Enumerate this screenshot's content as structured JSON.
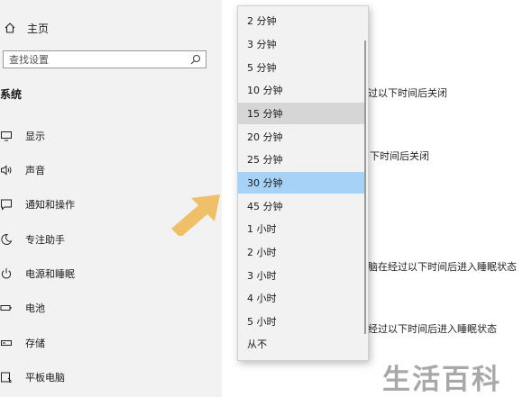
{
  "sidebar": {
    "home_label": "主页",
    "search_placeholder": "查找设置",
    "section_title": "系统",
    "items": [
      {
        "label": "显示",
        "icon": "monitor-icon"
      },
      {
        "label": "声音",
        "icon": "speaker-icon"
      },
      {
        "label": "通知和操作",
        "icon": "notification-icon"
      },
      {
        "label": "专注助手",
        "icon": "moon-icon"
      },
      {
        "label": "电源和睡眠",
        "icon": "power-icon"
      },
      {
        "label": "电池",
        "icon": "battery-icon"
      },
      {
        "label": "存储",
        "icon": "storage-icon"
      },
      {
        "label": "平板电脑",
        "icon": "tablet-icon"
      }
    ]
  },
  "content": {
    "line1": "过以下时间后关闭",
    "line2": "下时间后关闭",
    "line3": "脑在经过以下时间后进入睡眠状态",
    "line4": "经过以下时间后进入睡眠状态"
  },
  "dropdown": {
    "hovered_option": "15 分钟",
    "selected_option": "30 分钟",
    "options": [
      "2 分钟",
      "3 分钟",
      "5 分钟",
      "10 分钟",
      "15 分钟",
      "20 分钟",
      "25 分钟",
      "30 分钟",
      "45 分钟",
      "1 小时",
      "2 小时",
      "3 小时",
      "4 小时",
      "5 小时",
      "从不"
    ]
  },
  "watermark": "生活百科",
  "colors": {
    "sidebar_bg": "#f2f2f2",
    "selected_bg": "#a6d2f7",
    "hover_bg": "#d6d6d6",
    "arrow": "#f0b95a"
  }
}
